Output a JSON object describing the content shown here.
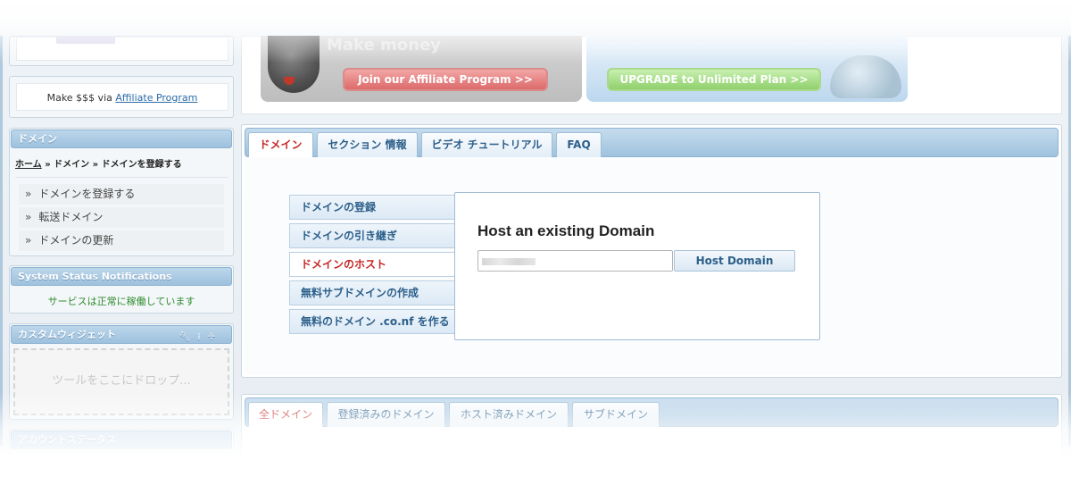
{
  "sidebar": {
    "affiliate": {
      "prefix": "Make $$$ via",
      "link": "Affiliate Program"
    },
    "domain_box": {
      "title": "ドメイン",
      "breadcrumb": {
        "home": "ホーム",
        "sep1": "»",
        "item1": "ドメイン",
        "sep2": "»",
        "item2": "ドメインを登録する"
      },
      "items": [
        {
          "marker": "»",
          "label": "ドメインを登録する"
        },
        {
          "marker": "»",
          "label": "転送ドメイン"
        },
        {
          "marker": "»",
          "label": "ドメインの更新"
        }
      ]
    },
    "status_box": {
      "title": "System Status Notifications",
      "text": "サービスは正常に稼働しています"
    },
    "widget_box": {
      "title": "カスタムウィジェット",
      "drop_text": "ツールをここにドロップ..."
    },
    "account_box": {
      "title": "アカウントステータス"
    }
  },
  "banners": {
    "affiliate": {
      "title": "Make money",
      "button": "Join our Affiliate Program >>"
    },
    "upgrade": {
      "button": "UPGRADE to Unlimited Plan >>"
    }
  },
  "main": {
    "tabs": [
      {
        "label": "ドメイン",
        "active": true
      },
      {
        "label": "セクション 情報",
        "active": false
      },
      {
        "label": "ビデオ チュートリアル",
        "active": false
      },
      {
        "label": "FAQ",
        "active": false
      }
    ],
    "menu": [
      {
        "label": "ドメインの登録",
        "active": false
      },
      {
        "label": "ドメインの引き継ぎ",
        "active": false
      },
      {
        "label": "ドメインのホスト",
        "active": true
      },
      {
        "label": "無料サブドメインの作成",
        "active": false
      },
      {
        "label": "無料のドメイン .co.nf を作る",
        "active": false
      }
    ],
    "host": {
      "title": "Host an existing Domain",
      "input_value": "",
      "button": "Host Domain"
    }
  },
  "lower": {
    "tabs": [
      {
        "label": "全ドメイン",
        "active": true
      },
      {
        "label": "登録済みのドメイン",
        "active": false
      },
      {
        "label": "ホスト済みドメイン",
        "active": false
      },
      {
        "label": "サブドメイン",
        "active": false
      }
    ]
  },
  "colors": {
    "accent_red": "#c62828",
    "link_blue": "#2a6aa8",
    "status_green": "#2e8b2e",
    "header_blue": "#9ec1de"
  }
}
